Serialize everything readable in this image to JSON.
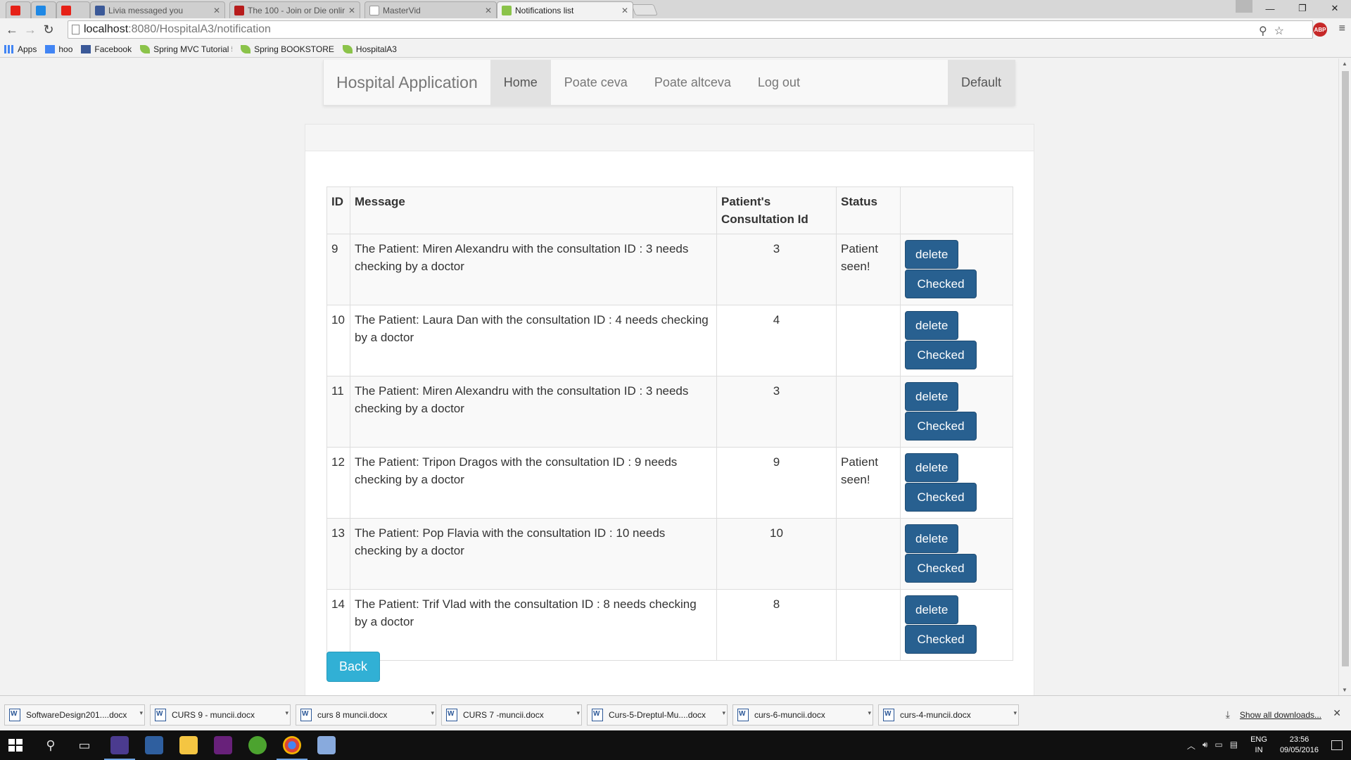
{
  "browser": {
    "tabs": [
      {
        "title": "",
        "favicon": "youtube-icon"
      },
      {
        "title": "",
        "favicon": "x-icon"
      },
      {
        "title": "",
        "favicon": "youtube-icon"
      },
      {
        "title": "Livia messaged you",
        "favicon": "facebook-icon"
      },
      {
        "title": "The 100 - Join or Die onlir",
        "favicon": "tv-icon"
      },
      {
        "title": "MasterVid",
        "favicon": "page-icon"
      },
      {
        "title": "Notifications list",
        "favicon": "leaf-icon"
      }
    ],
    "url_host": "localhost",
    "url_path": ":8080/HospitalA3/notification",
    "bookmarks": [
      {
        "label": "Apps",
        "icon": "apps-grid-icon"
      },
      {
        "label": "hoo",
        "icon": "translate-icon"
      },
      {
        "label": "Facebook",
        "icon": "facebook-icon"
      },
      {
        "label": "Spring MVC Tutorial 5",
        "icon": "leaf-icon"
      },
      {
        "label": "Spring BOOKSTORE",
        "icon": "leaf-icon"
      },
      {
        "label": "HospitalA3",
        "icon": "leaf-icon"
      }
    ]
  },
  "navbar": {
    "brand": "Hospital Application",
    "items": [
      "Home",
      "Poate ceva",
      "Poate altceva",
      "Log out"
    ],
    "active": "Home",
    "right_item": "Default"
  },
  "table": {
    "headers": [
      "ID",
      "Message",
      "Patient's Consultation Id",
      "Status",
      ""
    ],
    "rows": [
      {
        "id": "9",
        "message": "The Patient: Miren Alexandru with the consultation ID : 3 needs checking by a doctor",
        "consultation_id": "3",
        "status": "Patient seen!"
      },
      {
        "id": "10",
        "message": "The Patient: Laura Dan with the consultation ID : 4 needs checking by a doctor",
        "consultation_id": "4",
        "status": ""
      },
      {
        "id": "11",
        "message": "The Patient: Miren Alexandru with the consultation ID : 3 needs checking by a doctor",
        "consultation_id": "3",
        "status": ""
      },
      {
        "id": "12",
        "message": "The Patient: Tripon Dragos with the consultation ID : 9 needs checking by a doctor",
        "consultation_id": "9",
        "status": "Patient seen!"
      },
      {
        "id": "13",
        "message": "The Patient: Pop Flavia with the consultation ID : 10 needs checking by a doctor",
        "consultation_id": "10",
        "status": ""
      },
      {
        "id": "14",
        "message": "The Patient: Trif Vlad with the consultation ID : 8 needs checking by a doctor",
        "consultation_id": "8",
        "status": ""
      }
    ],
    "delete_label": "delete",
    "checked_label": "Checked"
  },
  "back_label": "Back",
  "downloads": {
    "items": [
      "SoftwareDesign201....docx",
      "CURS 9 - muncii.docx",
      "curs 8 muncii.docx",
      "CURS 7 -muncii.docx",
      "Curs-5-Dreptul-Mu....docx",
      "curs-6-muncii.docx",
      "curs-4-muncii.docx"
    ],
    "show_all": "Show all downloads..."
  },
  "taskbar": {
    "lang_top": "ENG",
    "lang_bottom": "IN",
    "time": "23:56",
    "date": "09/05/2016"
  },
  "colors": {
    "primary_button": "#286090",
    "info_button": "#31b0d5",
    "navbar_bg": "#f8f8f8"
  }
}
